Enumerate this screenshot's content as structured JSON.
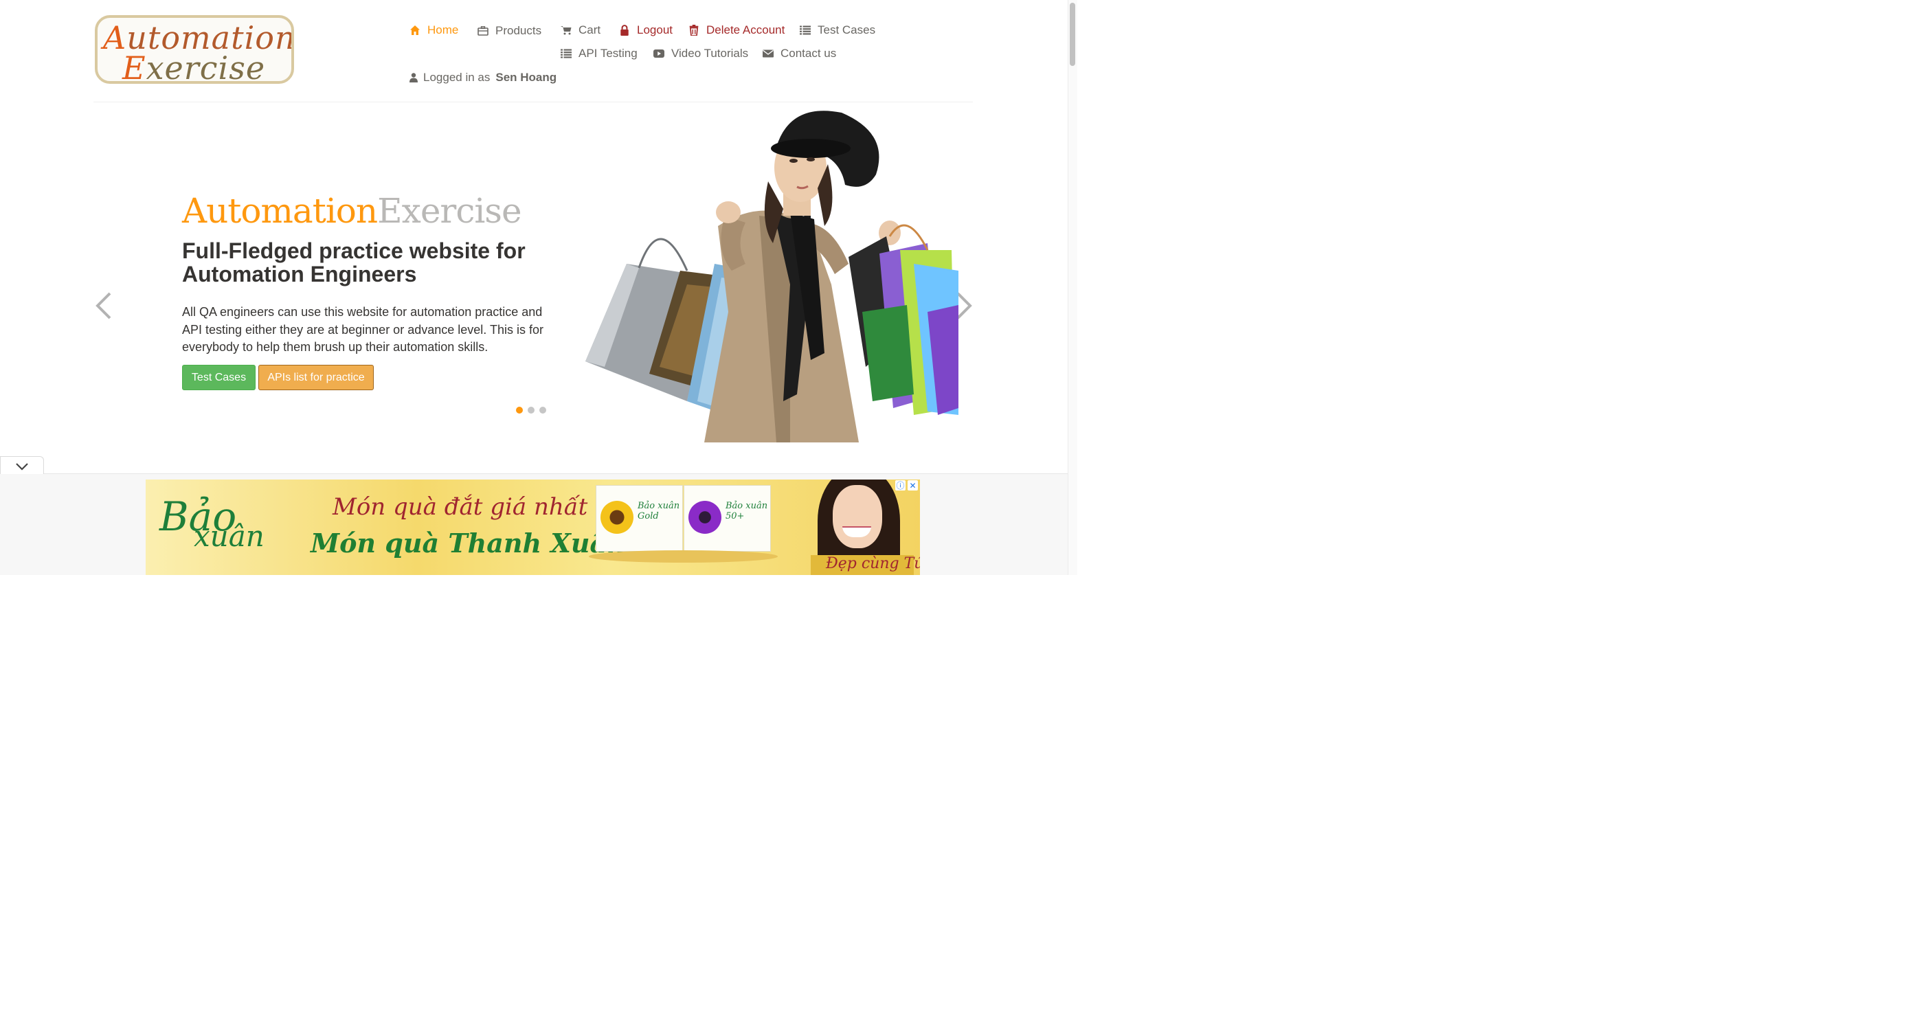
{
  "logo": {
    "line1_cap": "A",
    "line1_rest": "utomation",
    "line2_cap": "E",
    "line2_rest": "xercise"
  },
  "nav": {
    "home": "Home",
    "products": "Products",
    "cart": "Cart",
    "logout": "Logout",
    "delete_account": "Delete Account",
    "test_cases": "Test Cases",
    "api_testing": "API Testing",
    "video_tutorials": "Video Tutorials",
    "contact_us": "Contact us",
    "logged_in_prefix": "Logged in as",
    "logged_in_user": "Sen Hoang"
  },
  "slider": {
    "brand_part1": "Automation",
    "brand_part2": "Exercise",
    "headline": "Full-Fledged practice website for Automation Engineers",
    "description": "All QA engineers can use this website for automation practice and API testing either they are at beginner or advance level. This is for everybody to help them brush up their automation skills.",
    "btn_test_cases": "Test Cases",
    "btn_apis": "APIs list for practice",
    "slide_count": 3,
    "active_slide": 1
  },
  "ad": {
    "brand_line1": "Bảo",
    "brand_line2": "xuân",
    "tagline1": "Món quà đắt giá nhất là",
    "tagline2": "Món quà Thanh Xuân",
    "box_label_gold": "Bảo xuân Gold",
    "box_label_50": "Bảo xuân 50+",
    "signature": "Đẹp cùng Tú Vi",
    "info_icon": "ⓘ",
    "close_icon": "✕"
  },
  "colors": {
    "accent": "#fe980f",
    "danger": "#a52a2a",
    "text": "#696763",
    "heading": "#363432",
    "btn_green": "#5cb85c",
    "btn_orange": "#f0ad4e"
  }
}
